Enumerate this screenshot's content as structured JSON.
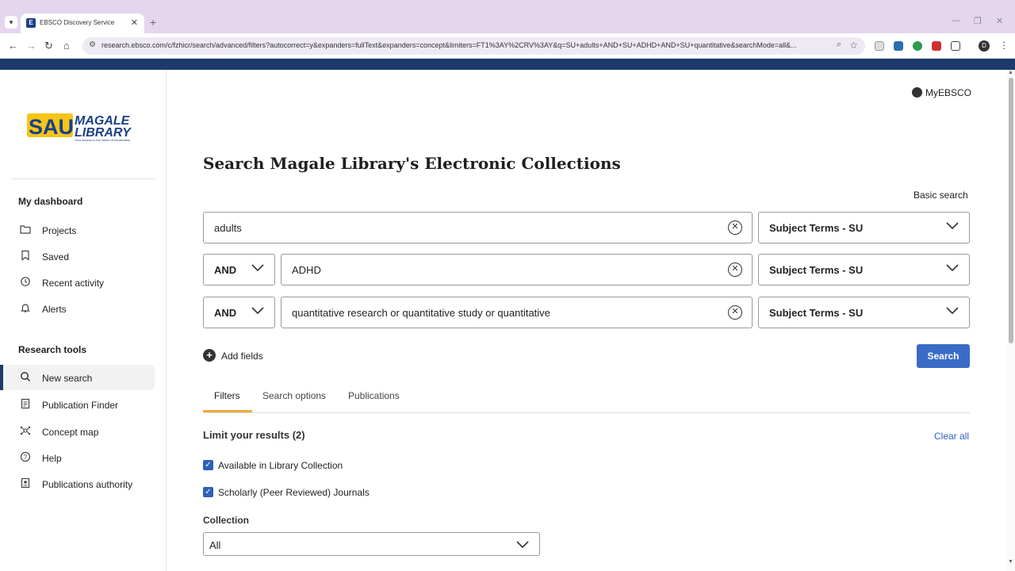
{
  "browser": {
    "tab_title": "EBSCO Discovery Service",
    "tab_favicon": "E",
    "url": "research.ebsco.com/c/fzhicr/search/advanced/filters?autocorrect=y&expanders=fullText&expanders=concept&limiters=FT1%3AY%2CRV%3AY&q=SU+adults+AND+SU+ADHD+AND+SU+quantitative&searchMode=all&...",
    "profile_initial": "D"
  },
  "sidebar": {
    "logo_sau": "SAU",
    "logo_magale": "MAGALE",
    "logo_library": "LIBRARY",
    "logo_tagline": "Your Access to the World of Information",
    "dashboard_heading": "My dashboard",
    "dashboard_items": [
      {
        "label": "Projects",
        "icon": "folder-icon"
      },
      {
        "label": "Saved",
        "icon": "bookmark-icon"
      },
      {
        "label": "Recent activity",
        "icon": "history-icon"
      },
      {
        "label": "Alerts",
        "icon": "bell-icon"
      }
    ],
    "tools_heading": "Research tools",
    "tools_items": [
      {
        "label": "New search",
        "icon": "search-icon"
      },
      {
        "label": "Publication Finder",
        "icon": "document-icon"
      },
      {
        "label": "Concept map",
        "icon": "network-icon"
      },
      {
        "label": "Help",
        "icon": "help-icon"
      },
      {
        "label": "Publications authority",
        "icon": "authority-icon"
      }
    ]
  },
  "header": {
    "myebsco": "MyEBSCO",
    "title": "Search Magale Library's Electronic Collections",
    "basic_search": "Basic search"
  },
  "search_rows": [
    {
      "operator": "",
      "term": "adults",
      "field": "Subject Terms - SU"
    },
    {
      "operator": "AND",
      "term": "ADHD",
      "field": "Subject Terms - SU"
    },
    {
      "operator": "AND",
      "term": "quantitative research or quantitative study or quantitative",
      "field": "Subject Terms - SU"
    }
  ],
  "actions": {
    "add_fields": "Add fields",
    "search": "Search"
  },
  "tabs": [
    "Filters",
    "Search options",
    "Publications"
  ],
  "filters": {
    "heading": "Limit your results (2)",
    "clear_all": "Clear all",
    "checkboxes": [
      {
        "label": "Available in Library Collection",
        "checked": true
      },
      {
        "label": "Scholarly (Peer Reviewed) Journals",
        "checked": true
      }
    ],
    "collection_label": "Collection",
    "collection_value": "All"
  },
  "colors": {
    "brand_blue": "#1c3a6b",
    "button_blue": "#3a6cc7",
    "tab_accent": "#f2a93b",
    "logo_yellow": "#f5c518"
  }
}
